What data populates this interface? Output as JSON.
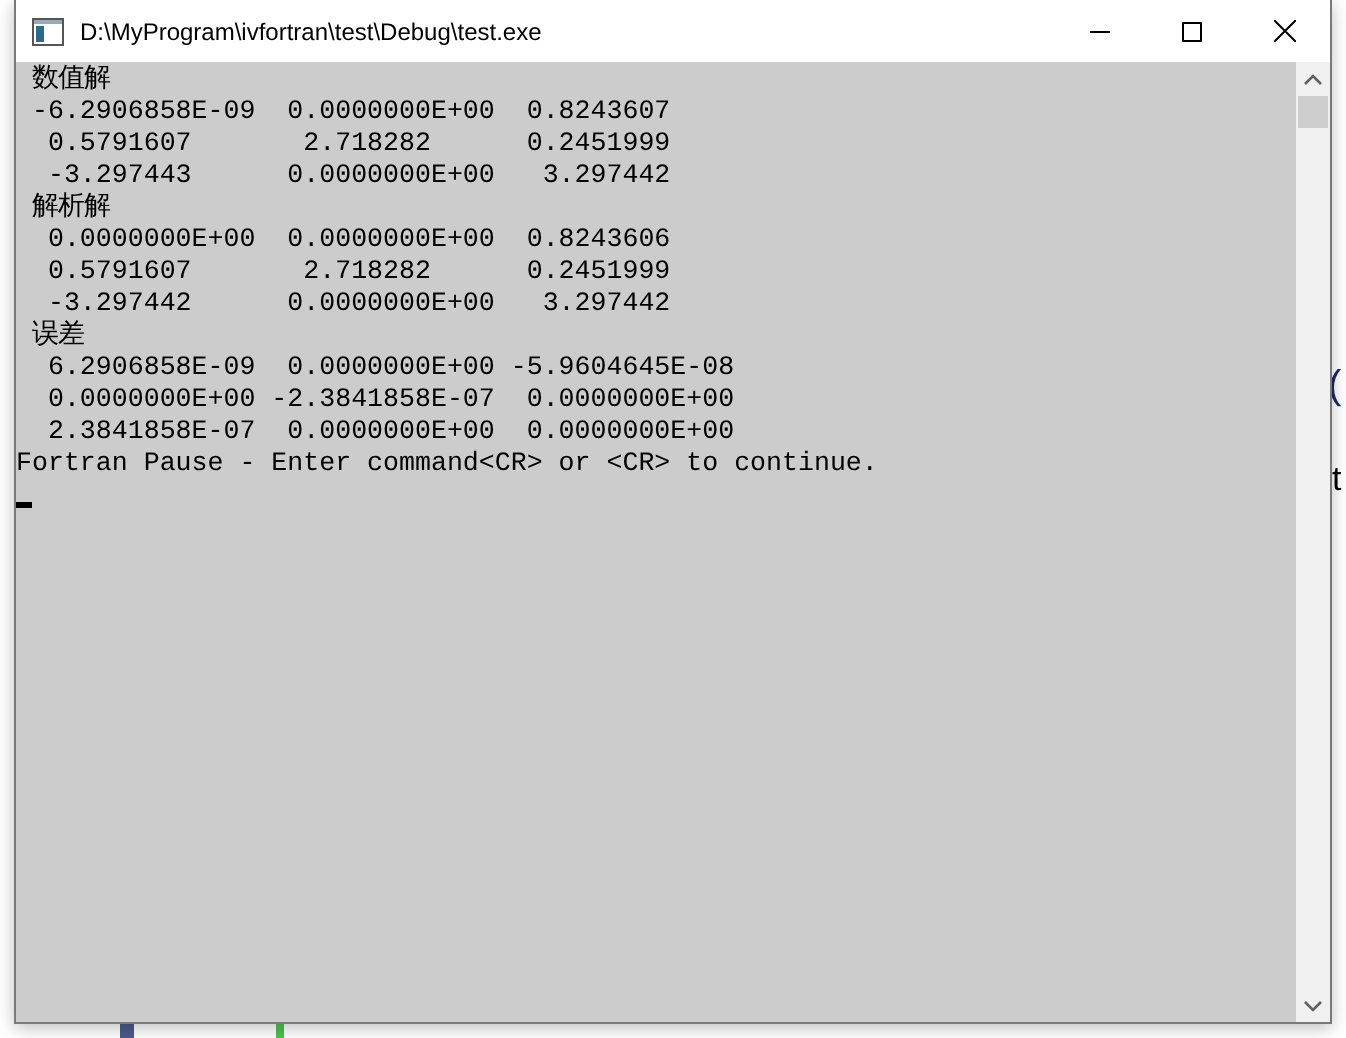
{
  "window": {
    "title": "D:\\MyProgram\\ivfortran\\test\\Debug\\test.exe"
  },
  "console": {
    "lines": [
      " 数值解",
      " -6.2906858E-09  0.0000000E+00  0.8243607",
      "  0.5791607       2.718282      0.2451999",
      "  -3.297443      0.0000000E+00   3.297442",
      " 解析解",
      "  0.0000000E+00  0.0000000E+00  0.8243606",
      "  0.5791607       2.718282      0.2451999",
      "  -3.297442      0.0000000E+00   3.297442",
      " 误差",
      "  6.2906858E-09  0.0000000E+00 -5.9604645E-08",
      "  0.0000000E+00 -2.3841858E-07  0.0000000E+00",
      "  2.3841858E-07  0.0000000E+00  0.0000000E+00",
      "Fortran Pause - Enter command<CR> or <CR> to continue."
    ]
  },
  "background_fragments": [
    "(",
    "t"
  ]
}
